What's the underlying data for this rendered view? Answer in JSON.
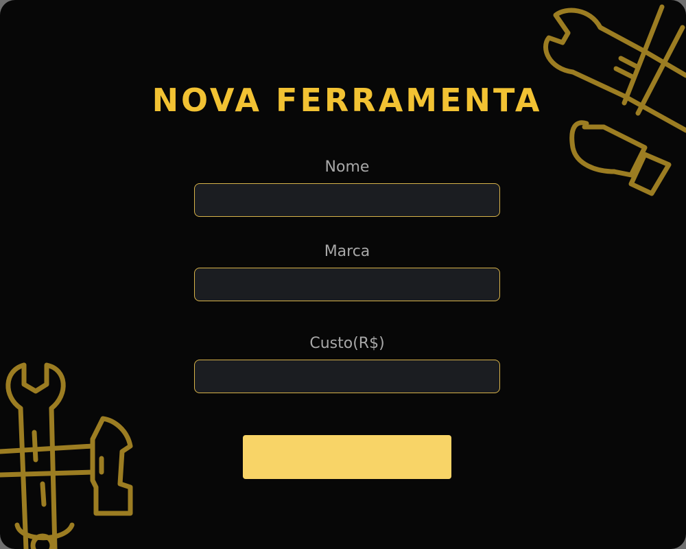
{
  "form": {
    "title": "NOVA FERRAMENTA",
    "fields": [
      {
        "label": "Nome",
        "value": "",
        "placeholder": ""
      },
      {
        "label": "Marca",
        "value": "",
        "placeholder": ""
      },
      {
        "label": "Custo(R$)",
        "value": "",
        "placeholder": ""
      }
    ],
    "submit_label": ""
  },
  "decorations": {
    "top_right": "tools-icon",
    "bottom_left": "tools-icon"
  },
  "colors": {
    "background": "#070707",
    "accent": "#f2c233",
    "button": "#f8d467",
    "input_background": "#1b1d21",
    "input_border": "#d9b44a",
    "label": "#a8a8a8",
    "decoration": "#9c7d22"
  }
}
